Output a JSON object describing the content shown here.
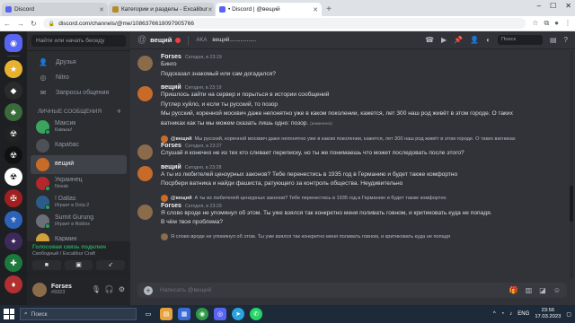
{
  "browser": {
    "tabs": [
      {
        "title": "Discord",
        "favicon_color": "#5865f2",
        "active": false
      },
      {
        "title": "Категории и разделы - Excalibur",
        "favicon_color": "#b48a2c",
        "active": false
      },
      {
        "title": "• Discord | @вещий",
        "favicon_color": "#5865f2",
        "active": true
      }
    ],
    "url": "discord.com/channels/@me/1086376618097905766"
  },
  "sidebar": {
    "search_placeholder": "Найти или начать беседу",
    "nav": [
      {
        "label": "Друзья",
        "icon": "friends-icon"
      },
      {
        "label": "Nitro",
        "icon": "nitro-icon"
      },
      {
        "label": "Запросы общения",
        "icon": "message-requests-icon"
      }
    ],
    "dm_header": "ЛИЧНЫЕ СООБЩЕНИЯ",
    "dms": [
      {
        "name": "Максик",
        "sub": "Камыш!",
        "color": "#3ba55d",
        "active": false
      },
      {
        "name": "Карабас",
        "sub": "",
        "color": "#4e5058",
        "active": false
      },
      {
        "name": "вещий",
        "sub": "",
        "color": "#c86b28",
        "active": true
      },
      {
        "name": "Украинец",
        "sub": "Novak",
        "color": "#b3282d",
        "active": false
      },
      {
        "name": "! Dallas",
        "sub": "Играет в Dota 2",
        "color": "#2d5c8a",
        "active": false
      },
      {
        "name": "Sumit Gurung",
        "sub": "Играет в Roblox",
        "color": "#6b6f77",
        "active": false
      },
      {
        "name": "Кармин",
        "sub": "",
        "color": "#d1a23a",
        "active": false
      }
    ],
    "voice": {
      "status": "Голосовая связь подключ",
      "sub": "Свободный / Excalibur Craft"
    },
    "user": {
      "name": "Forses",
      "tag": "#9323"
    }
  },
  "chat": {
    "title": "вещий",
    "aka_label": "AKA",
    "aka_name": "вещий.................",
    "search_placeholder": "Поиск",
    "composer_placeholder": "Написать @вещий",
    "messages": [
      {
        "author": "Forses",
        "time": "Сегодня, в 23:19",
        "avatar_color": "#8a6b4a",
        "lines": [
          "Бинго",
          "Подсказал знакомый или сам догадался?"
        ]
      },
      {
        "author": "вещий",
        "time": "Сегодня, в 23:19",
        "avatar_color": "#c86b28",
        "lines": [
          "Пришлось зайти на сервер и порыться в истории сообщений",
          "Путлер хуйло, и если ты русский, то позор",
          "Мы русский, коренной москвич даже непонятно уже в каком поколении, кажется, лет 300 наш род живёт в этом городе. О таких",
          "ватниках как ты мы можем сказать лишь одно: позор."
        ],
        "edited": "(изменено)"
      },
      {
        "reply_to": "@вещий",
        "reply_text": "Мы русский, коренной москвич даже непонятно уже в каком поколении, кажется, лет 300 наш род живёт в этом городе. О таких ватниках",
        "author": "Forses",
        "time": "Сегодня, в 23:27",
        "avatar_color": "#8a6b4a",
        "lines": [
          "Слушай я конечно не из тех кто сливает переписку, но ты же понимаешь что может последовать после этого?"
        ]
      },
      {
        "author": "вещий",
        "time": "Сегодня, в 23:28",
        "avatar_color": "#c86b28",
        "lines": [
          "А ты из любителей цензурных законов? Тебе перенестись в 1935 год в Германию и будет также комфортно",
          "Посрбери ватника и найди фашиста, ратующего за контроль общества. Неудивительно"
        ]
      },
      {
        "reply_to": "@вещий",
        "reply_text": "А ты из любителей цензурных законов? Тебе перенестись в 1935 год в Германию и будет также комфортно",
        "author": "Forses",
        "time": "Сегодня, в 23:29",
        "avatar_color": "#8a6b4a",
        "lines": [
          "Я слово вроде не упомянул об этом. Ты уже взялся так конкретно меня поливать говном, и критиковать куда не попадя.",
          "В чём твоя проблема?"
        ]
      }
    ],
    "partial_reply": "Я слово вроде не упомянул об этом. Ты уже взялся так конкретно меня поливать говном, и критиковать куда не попадя"
  },
  "taskbar": {
    "search_placeholder": "Поиск",
    "lang": "ENG",
    "time": "23:56",
    "date": "17.03.2023"
  }
}
